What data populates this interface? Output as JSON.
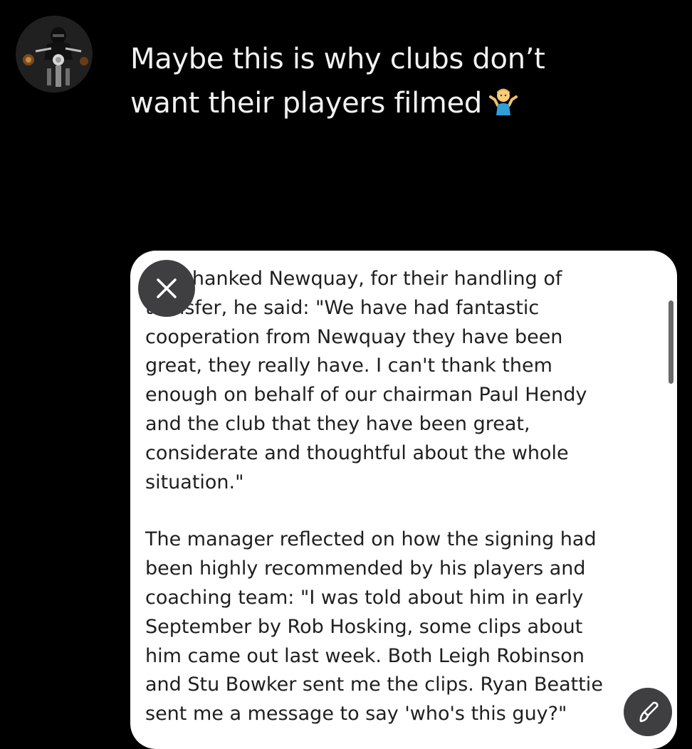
{
  "post": {
    "line1": "Maybe this is why clubs don’t",
    "line2": "want their players filmed",
    "emoji_icon": "person-shrugging-icon"
  },
  "article": {
    "lines": [
      "sey thanked Newquay, for their handling of",
      "transfer, he said: \"We have had fantastic",
      "cooperation from Newquay they have been",
      "great, they really have. I can't thank them",
      "enough on behalf of our chairman Paul Hendy",
      "and the club that they have been great,",
      "considerate and thoughtful about the whole",
      "situation.\"",
      "The manager reflected on how the signing had",
      "been highly recommended by his players and",
      "coaching team: \"I was told about him in early",
      "September by Rob Hosking, some clips about",
      "him came out last week. Both Leigh Robinson",
      "and Stu Bowker sent me the clips. Ryan Beattie",
      "sent me a message to say 'who's this guy?\""
    ]
  },
  "controls": {
    "close_icon": "close-icon",
    "edit_icon": "brush-icon"
  },
  "colors": {
    "background": "#000000",
    "card": "#ffffff",
    "button": "#3f3f41",
    "post_text": "#f2f2f2",
    "article_text": "#1f1f1f"
  }
}
